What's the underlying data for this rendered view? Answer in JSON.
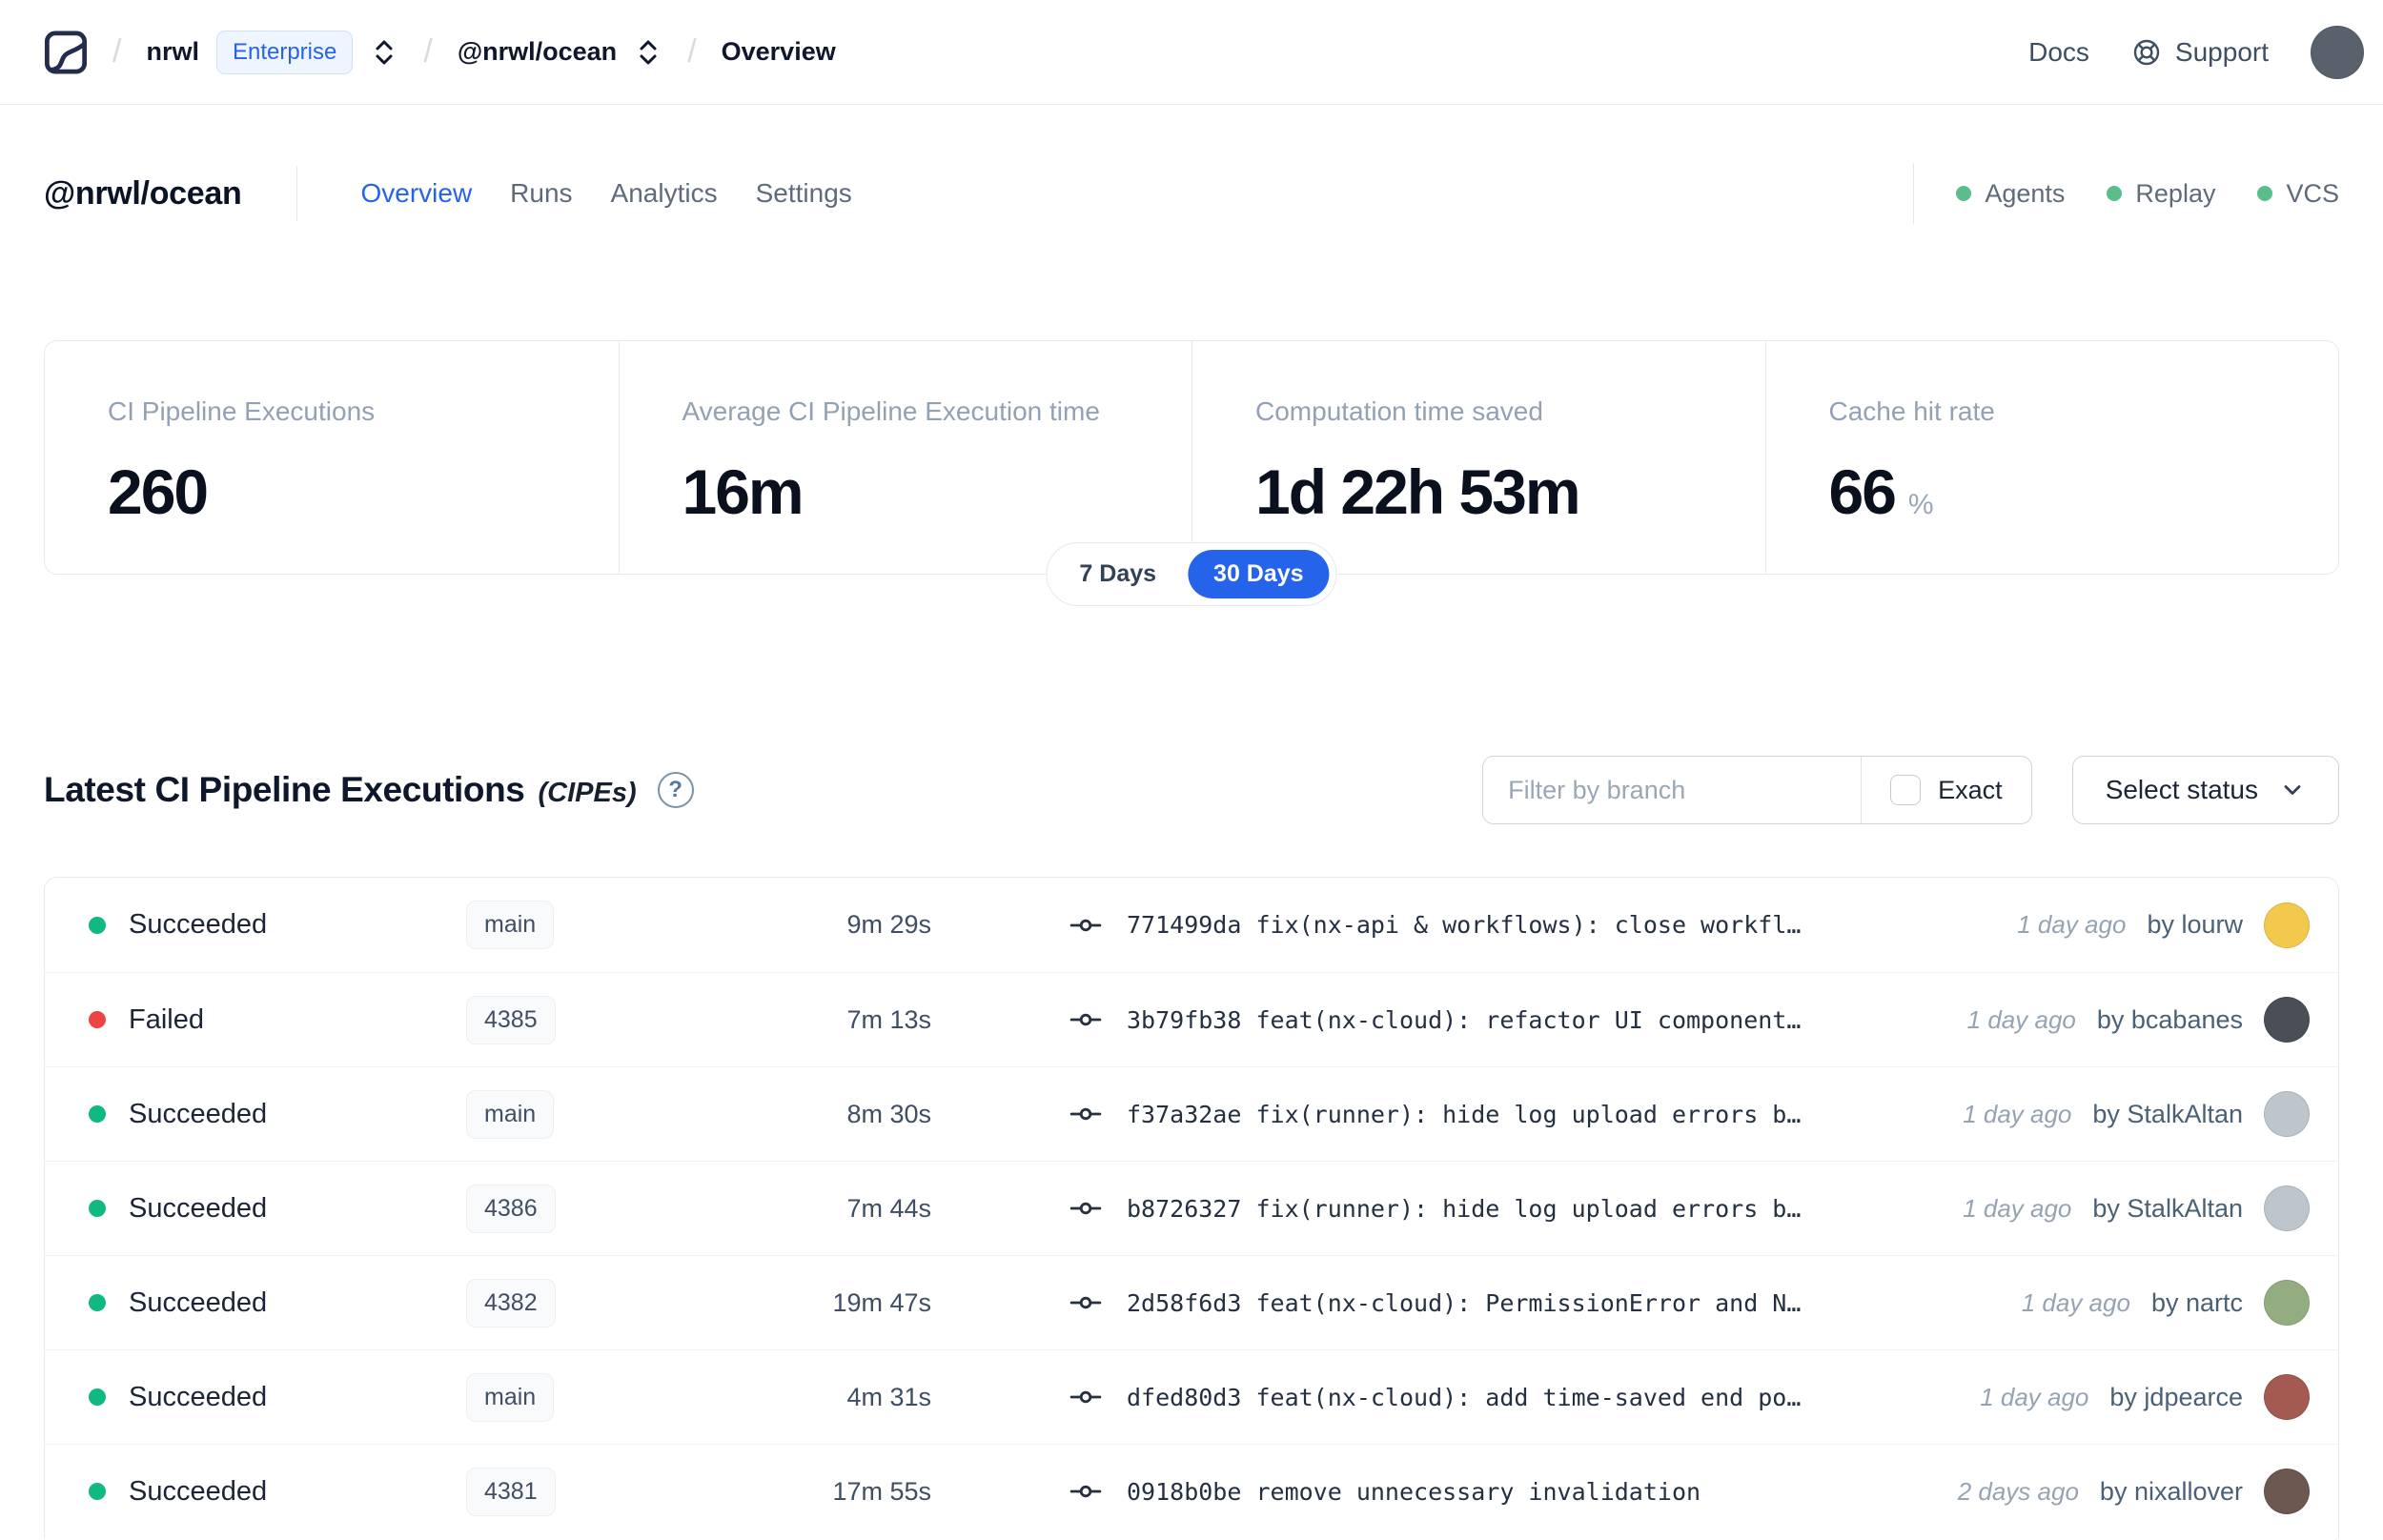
{
  "navbar": {
    "org": "nrwl",
    "org_badge": "Enterprise",
    "workspace": "@nrwl/ocean",
    "page": "Overview",
    "docs_label": "Docs",
    "support_label": "Support",
    "user_avatar_color": "#59626c"
  },
  "workspace_header": {
    "title": "@nrwl/ocean",
    "tabs": [
      {
        "label": "Overview"
      },
      {
        "label": "Runs"
      },
      {
        "label": "Analytics"
      },
      {
        "label": "Settings"
      }
    ],
    "integrations": [
      {
        "label": "Agents",
        "color": "#5bbd8c"
      },
      {
        "label": "Replay",
        "color": "#5bbd8c"
      },
      {
        "label": "VCS",
        "color": "#5bbd8c"
      }
    ]
  },
  "stats": {
    "cards": [
      {
        "label": "CI Pipeline Executions",
        "value": "260",
        "suffix": ""
      },
      {
        "label": "Average CI Pipeline Execution time",
        "value": "16m",
        "suffix": ""
      },
      {
        "label": "Computation time saved",
        "value": "1d 22h 53m",
        "suffix": ""
      },
      {
        "label": "Cache hit rate",
        "value": "66",
        "suffix": "%"
      }
    ],
    "range_toggle": {
      "inactive": "7 Days",
      "active": "30 Days",
      "active_color": "#2563eb"
    }
  },
  "cipes": {
    "title": "Latest CI Pipeline Executions",
    "title_note": "(CIPEs)",
    "help_glyph": "?",
    "filter_placeholder": "Filter by branch",
    "exact_label": "Exact",
    "status_select_label": "Select status",
    "rows": [
      {
        "status": "Succeeded",
        "dot": "#10b981",
        "branch": "main",
        "duration": "9m 29s",
        "commit": "771499da fix(nx-api & workflows): close workfl…",
        "time": "1 day ago",
        "author": "by lourw",
        "avatar": "#f2c94c"
      },
      {
        "status": "Failed",
        "dot": "#ef4444",
        "branch": "4385",
        "duration": "7m 13s",
        "commit": "3b79fb38 feat(nx-cloud): refactor UI component…",
        "time": "1 day ago",
        "author": "by bcabanes",
        "avatar": "#4a4f57"
      },
      {
        "status": "Succeeded",
        "dot": "#10b981",
        "branch": "main",
        "duration": "8m 30s",
        "commit": "f37a32ae fix(runner): hide log upload errors b…",
        "time": "1 day ago",
        "author": "by StalkAltan",
        "avatar": "#bcc6cc"
      },
      {
        "status": "Succeeded",
        "dot": "#10b981",
        "branch": "4386",
        "duration": "7m 44s",
        "commit": "b8726327 fix(runner): hide log upload errors b…",
        "time": "1 day ago",
        "author": "by StalkAltan",
        "avatar": "#bcc6cc"
      },
      {
        "status": "Succeeded",
        "dot": "#10b981",
        "branch": "4382",
        "duration": "19m 47s",
        "commit": "2d58f6d3 feat(nx-cloud): PermissionError and N…",
        "time": "1 day ago",
        "author": "by nartc",
        "avatar": "#93ad80"
      },
      {
        "status": "Succeeded",
        "dot": "#10b981",
        "branch": "main",
        "duration": "4m 31s",
        "commit": "dfed80d3 feat(nx-cloud): add time-saved end po…",
        "time": "1 day ago",
        "author": "by jdpearce",
        "avatar": "#a45a50"
      },
      {
        "status": "Succeeded",
        "dot": "#10b981",
        "branch": "4381",
        "duration": "17m 55s",
        "commit": "0918b0be remove unnecessary invalidation",
        "time": "2 days ago",
        "author": "by nixallover",
        "avatar": "#6d5850"
      }
    ]
  }
}
